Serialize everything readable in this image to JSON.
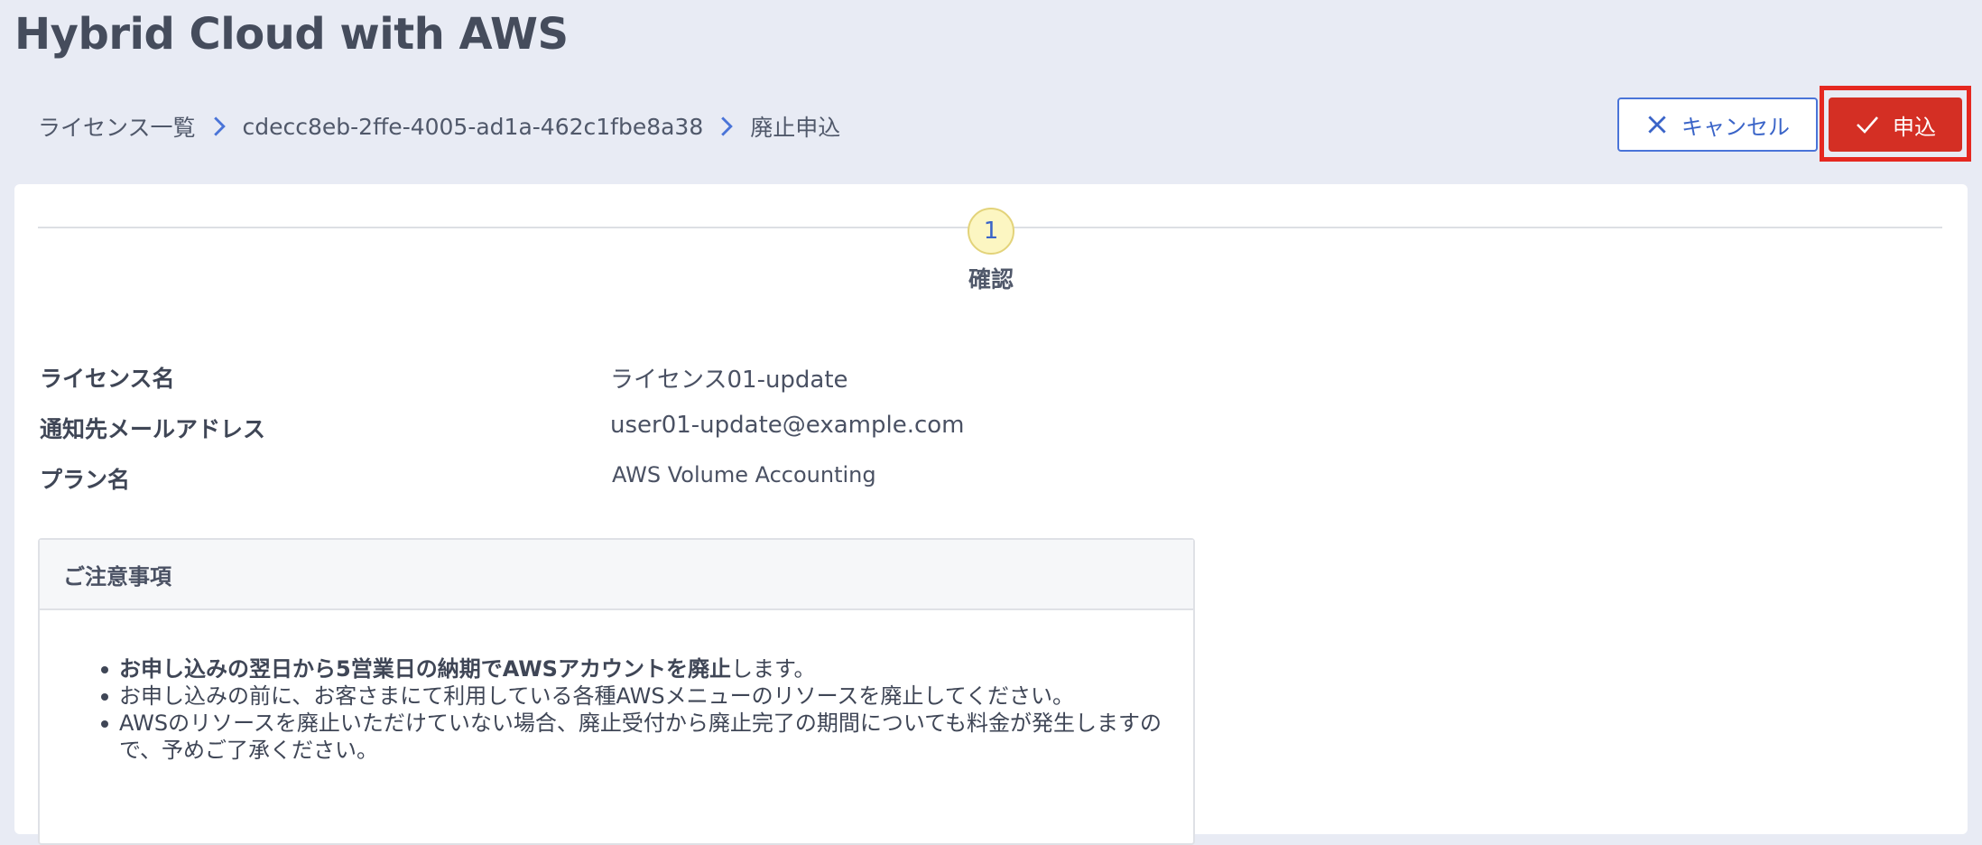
{
  "app": {
    "title": "Hybrid Cloud with AWS"
  },
  "breadcrumb": {
    "items": [
      "ライセンス一覧",
      "cdecc8eb-2ffe-4005-ad1a-462c1fbe8a38",
      "廃止申込"
    ]
  },
  "actions": {
    "cancel_label": "キャンセル",
    "submit_label": "申込"
  },
  "stepper": {
    "number": "1",
    "label": "確認"
  },
  "fields": [
    {
      "label": "ライセンス名",
      "value": "ライセンス01-update"
    },
    {
      "label": "通知先メールアドレス",
      "value": "user01-update@example.com"
    },
    {
      "label": "プラン名",
      "value": "AWS Volume Accounting"
    }
  ],
  "notice": {
    "title": "ご注意事項",
    "items": [
      {
        "bold": "お申し込みの翌日から5営業日の納期でAWSアカウントを廃止",
        "rest": "します。"
      },
      {
        "bold": "",
        "rest": "お申し込みの前に、お客さまにて利用している各種AWSメニューのリソースを廃止してください。"
      },
      {
        "bold": "",
        "rest": "AWSのリソースを廃止いただけていない場合、廃止受付から廃止完了の期間についても料金が発生しますので、予めご了承ください。"
      }
    ]
  },
  "colors": {
    "background": "#e8ebf4",
    "primary_blue": "#3a64c8",
    "submit_red": "#d42f24",
    "highlight_frame": "#e52820",
    "step_circle": "#fcf6c2"
  },
  "icons": {
    "breadcrumb_separator": "chevron-right-icon",
    "cancel": "close-icon",
    "submit": "check-icon"
  }
}
